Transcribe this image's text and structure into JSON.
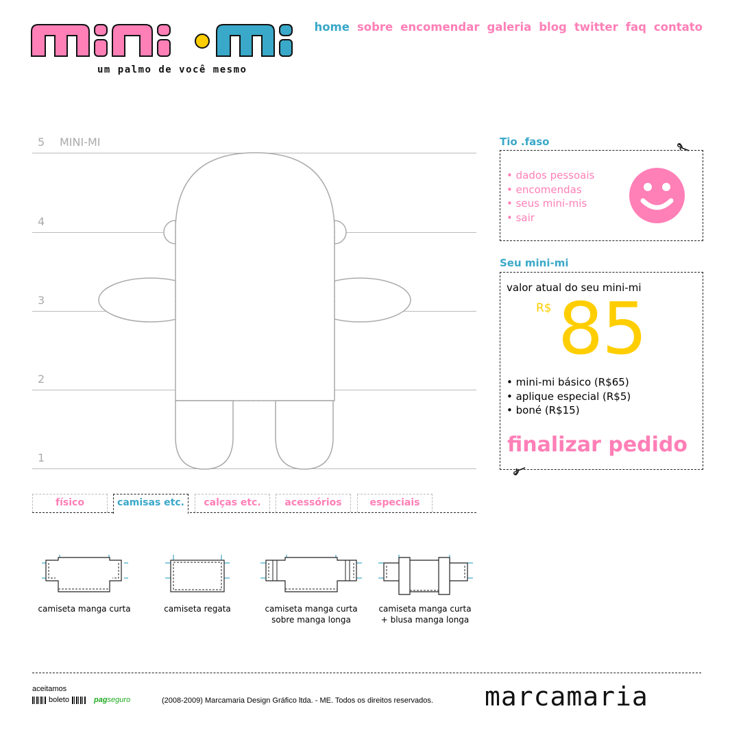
{
  "logo": {
    "text": "mini-mi",
    "tagline": "um palmo de você mesmo"
  },
  "nav": [
    {
      "label": "home",
      "active": true
    },
    {
      "label": "sobre",
      "active": false
    },
    {
      "label": "encomendar",
      "active": false
    },
    {
      "label": "galeria",
      "active": false
    },
    {
      "label": "blog",
      "active": false
    },
    {
      "label": "twitter",
      "active": false
    },
    {
      "label": "faq",
      "active": false
    },
    {
      "label": "contato",
      "active": false
    }
  ],
  "measure": {
    "title": "MINI-MI",
    "levels": [
      "5",
      "4",
      "3",
      "2",
      "1"
    ]
  },
  "user_panel": {
    "heading": "Tio .faso",
    "links": [
      "• dados pessoais",
      "• encomendas",
      "• seus mini-mis",
      "• sair"
    ]
  },
  "order_panel": {
    "heading": "Seu mini-mi",
    "caption": "valor atual do seu mini-mi",
    "currency": "R$",
    "price": "85",
    "items": [
      "• mini-mi básico (R$65)",
      "• aplique especial (R$5)",
      "• boné (R$15)"
    ],
    "checkout_label": "finalizar pedido"
  },
  "tabs": [
    {
      "label": "físico",
      "active": false
    },
    {
      "label": "camisas etc.",
      "active": true
    },
    {
      "label": "calças etc.",
      "active": false
    },
    {
      "label": "acessórios",
      "active": false
    },
    {
      "label": "especiais",
      "active": false
    }
  ],
  "shirts": [
    {
      "line1": "camiseta manga curta",
      "line2": ""
    },
    {
      "line1": "camiseta regata",
      "line2": ""
    },
    {
      "line1": "camiseta manga curta",
      "line2": "sobre manga longa"
    },
    {
      "line1": "camiseta manga curta",
      "line2": "+ blusa manga longa"
    }
  ],
  "footer": {
    "accept_title": "aceitamos",
    "boleto": "boleto",
    "pagseguro": "pag",
    "pagseguro_sub": "seguro",
    "copyright": "(2008-2009) Marcamaria Design Gráfico ltda. - ME. Todos os direitos reservados.",
    "brand": "marcamaria"
  },
  "colors": {
    "pink": "#ff7fb7",
    "blue": "#3aa8c8",
    "yellow": "#ffce00"
  }
}
